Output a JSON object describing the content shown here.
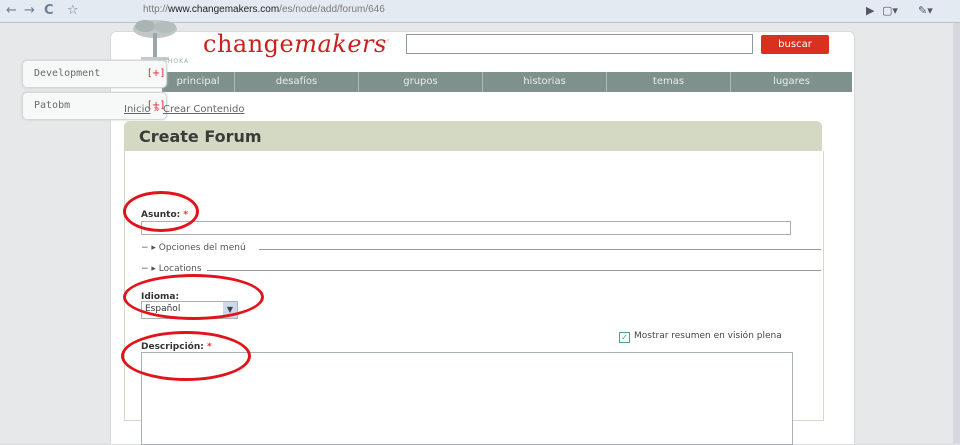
{
  "browser": {
    "url_prefix": "http://",
    "url_domain": "www.changemakers.com",
    "url_path": "/es/node/add/forum/646",
    "back_icon": "arrow-left",
    "forward_icon": "arrow-right",
    "reload_icon": "reload",
    "star_icon": "star"
  },
  "header": {
    "logo_main": "change",
    "logo_italic": "makers",
    "logo_sub": "ASHOKA",
    "search_value": "",
    "search_button": "buscar"
  },
  "nav": [
    "principal",
    "desafíos",
    "grupos",
    "historias",
    "temas",
    "lugares"
  ],
  "side_tabs": [
    {
      "label": "Development",
      "toggle": "[+]"
    },
    {
      "label": "Patobm",
      "toggle": "[+]"
    }
  ],
  "breadcrumb": {
    "home": "Inicio",
    "sep": "»",
    "current": "Crear Contenido"
  },
  "form": {
    "title": "Create Forum",
    "subject_label": "Asunto:",
    "required_mark": "*",
    "subject_value": "",
    "menu_options": "Opciones del menú",
    "locations": "Locations",
    "language_label": "Idioma:",
    "language_value": "Español",
    "summary_checkbox": "Mostrar resumen en visión plena",
    "summary_checked": true,
    "description_label": "Descripción:",
    "description_value": ""
  },
  "colors": {
    "accent_red": "#d9311f",
    "annotation_red": "#e0151c",
    "nav_bg": "#7f918c",
    "title_bg": "#d3d9c2"
  }
}
